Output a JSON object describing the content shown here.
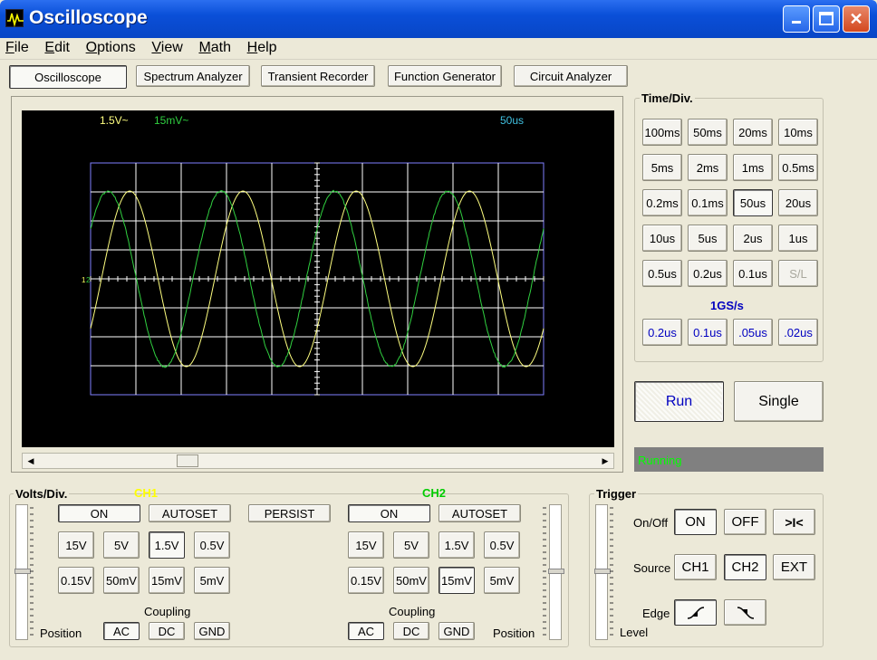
{
  "window": {
    "title": "Oscilloscope"
  },
  "menu": [
    "File",
    "Edit",
    "Options",
    "View",
    "Math",
    "Help"
  ],
  "tabs": [
    {
      "label": "Oscilloscope",
      "active": true
    },
    {
      "label": "Spectrum Analyzer",
      "active": false
    },
    {
      "label": "Transient Recorder",
      "active": false
    },
    {
      "label": "Function Generator",
      "active": false
    },
    {
      "label": "Circuit Analyzer",
      "active": false
    }
  ],
  "screen": {
    "ch1_scale": "1.5V~",
    "ch2_scale": "15mV~",
    "timebase": "50us",
    "ch1_color": "#ffff80",
    "ch2_color": "#30d040",
    "grid_color": "#ffffff",
    "ch1_marker": "1",
    "ch2_marker": "2"
  },
  "timediv": {
    "label": "Time/Div.",
    "rows": [
      [
        "100ms",
        "50ms",
        "20ms",
        "10ms"
      ],
      [
        "5ms",
        "2ms",
        "1ms",
        "0.5ms"
      ],
      [
        "0.2ms",
        "0.1ms",
        "50us",
        "20us"
      ],
      [
        "10us",
        "5us",
        "2us",
        "1us"
      ],
      [
        "0.5us",
        "0.2us",
        "0.1us",
        "S/L"
      ]
    ],
    "selected": "50us",
    "disabled": "S/L",
    "sample_rate": "1GS/s",
    "fast": [
      ".2us",
      "0.1us",
      ".05us",
      ".02us"
    ],
    "fast_labels": [
      "0.2us",
      "0.1us",
      ".05us",
      ".02us"
    ]
  },
  "run": {
    "run_label": "Run",
    "single_label": "Single",
    "status": "Running"
  },
  "volts": {
    "label": "Volts/Div.",
    "position_label": "Position",
    "coupling_label": "Coupling",
    "persist_label": "PERSIST",
    "ch1": {
      "title": "CH1",
      "on": "ON",
      "autoset": "AUTOSET",
      "rows": [
        [
          "15V",
          "5V",
          "1.5V",
          "0.5V"
        ],
        [
          "0.15V",
          "50mV",
          "15mV",
          "5mV"
        ]
      ],
      "selected": "1.5V",
      "coupling": [
        "AC",
        "DC",
        "GND"
      ],
      "coupling_selected": "AC",
      "color": "#ffff00"
    },
    "ch2": {
      "title": "CH2",
      "on": "ON",
      "autoset": "AUTOSET",
      "rows": [
        [
          "15V",
          "5V",
          "1.5V",
          "0.5V"
        ],
        [
          "0.15V",
          "50mV",
          "15mV",
          "5mV"
        ]
      ],
      "selected": "15mV",
      "coupling": [
        "AC",
        "DC",
        "GND"
      ],
      "coupling_selected": "AC",
      "color": "#00cc00"
    }
  },
  "trigger": {
    "label": "Trigger",
    "onoff_label": "On/Off",
    "on": "ON",
    "off": "OFF",
    "auto": ">I<",
    "source_label": "Source",
    "sources": [
      "CH1",
      "CH2",
      "EXT"
    ],
    "source_selected": "CH2",
    "edge_label": "Edge",
    "level_label": "Level"
  }
}
